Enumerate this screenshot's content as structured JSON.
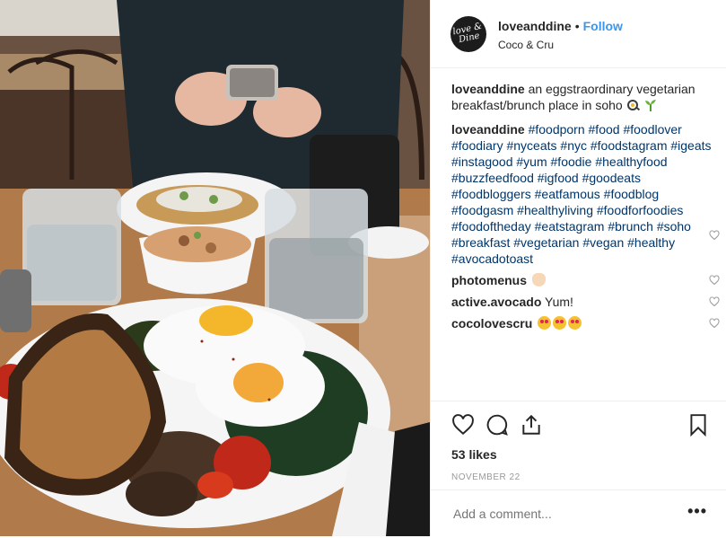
{
  "header": {
    "avatar_text": "love & Dine",
    "username": "loveanddine",
    "separator": "•",
    "follow_label": "Follow",
    "location": "Coco & Cru"
  },
  "caption": {
    "username": "loveanddine",
    "text": "an eggstraordinary vegetarian breakfast/brunch place in soho",
    "emoji_icons": [
      "frying-pan-egg-icon",
      "seedling-icon"
    ]
  },
  "hashtag_comment": {
    "username": "loveanddine",
    "tags": "#foodporn #food #foodlover #foodiary #nyceats #nyc #foodstagram #igeats #instagood #yum #foodie #healthyfood #buzzfeedfood #igfood #goodeats #foodbloggers #eatfamous #foodblog #foodgasm #healthyliving #foodforfoodies #foodoftheday #eatstagram #brunch #soho #breakfast #vegetarian #vegan #healthy #avocadotoast"
  },
  "comments": [
    {
      "username": "photomenus",
      "text": "",
      "emoji": "ok-hand-icon"
    },
    {
      "username": "active.avocado",
      "text": "Yum!",
      "emoji": ""
    },
    {
      "username": "cocolovescru",
      "text": "",
      "emoji": "heart-eyes-icon x3"
    }
  ],
  "likes": "53 likes",
  "date": "NOVEMBER 22",
  "add_comment": {
    "placeholder": "Add a comment..."
  },
  "more_label": "•••",
  "colors": {
    "link": "#003569",
    "follow": "#3897f0",
    "muted": "#999999",
    "text": "#262626"
  }
}
